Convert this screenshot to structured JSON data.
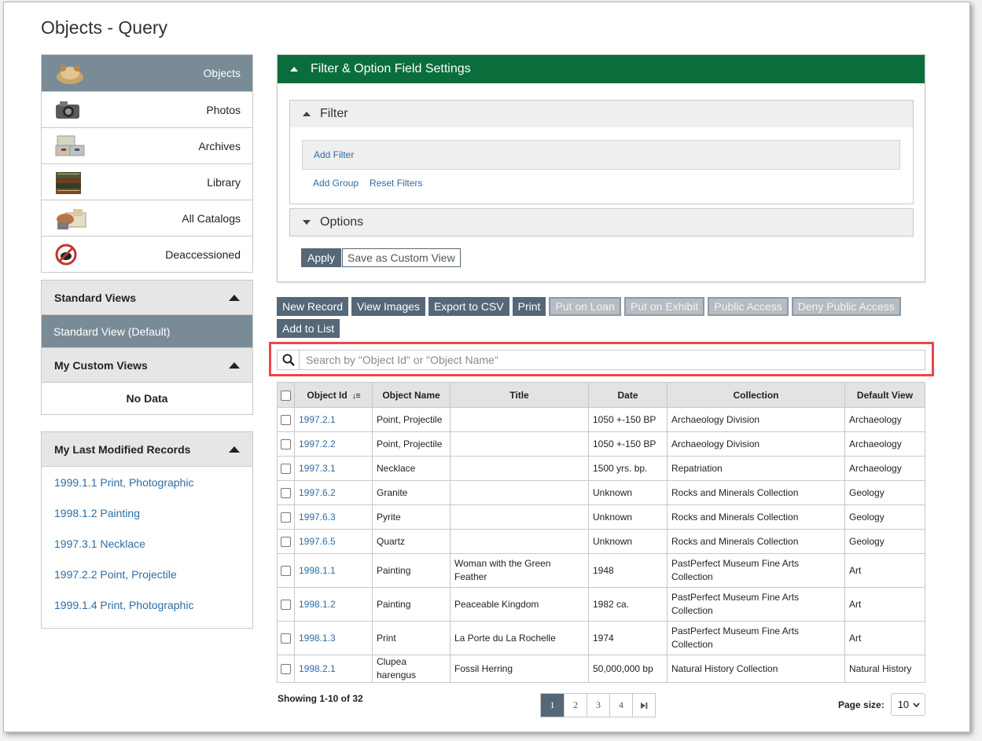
{
  "page": {
    "title": "Objects - Query"
  },
  "categories": [
    {
      "label": "Objects",
      "icon": "objects-thumbnail-icon",
      "active": true
    },
    {
      "label": "Photos",
      "icon": "camera-thumbnail-icon",
      "active": false
    },
    {
      "label": "Archives",
      "icon": "archive-boxes-thumbnail-icon",
      "active": false
    },
    {
      "label": "Library",
      "icon": "books-thumbnail-icon",
      "active": false
    },
    {
      "label": "All Catalogs",
      "icon": "catalog-items-thumbnail-icon",
      "active": false
    },
    {
      "label": "Deaccessioned",
      "icon": "deaccession-icon",
      "active": false
    }
  ],
  "views": {
    "standard_title": "Standard Views",
    "standard_item": "Standard View (Default)",
    "custom_title": "My Custom Views",
    "custom_empty": "No Data"
  },
  "recent": {
    "title": "My Last Modified Records",
    "items": [
      "1999.1.1 Print, Photographic",
      "1998.1.2 Painting",
      "1997.3.1 Necklace",
      "1997.2.2 Point, Projectile",
      "1999.1.4 Print, Photographic"
    ]
  },
  "filter_panel": {
    "title": "Filter & Option Field Settings",
    "filter_title": "Filter",
    "add_filter": "Add Filter",
    "add_group": "Add Group",
    "reset_filters": "Reset Filters",
    "options_title": "Options",
    "apply": "Apply",
    "save_custom": "Save as Custom View"
  },
  "toolbar": {
    "new_record": "New Record",
    "view_images": "View Images",
    "export_csv": "Export to CSV",
    "print": "Print",
    "put_on_loan": "Put on Loan",
    "put_on_exhibit": "Put on Exhibit",
    "public_access": "Public Access",
    "deny_public_access": "Deny Public Access",
    "add_to_list": "Add to List"
  },
  "search": {
    "placeholder": "Search by \"Object Id\" or \"Object Name\"",
    "highlight_color": "#e8474c"
  },
  "table": {
    "headers": [
      "Object Id",
      "Object Name",
      "Title",
      "Date",
      "Collection",
      "Default View"
    ],
    "rows": [
      [
        "1997.2.1",
        "Point, Projectile",
        "",
        "1050 +-150 BP",
        "Archaeology Division",
        "Archaeology"
      ],
      [
        "1997.2.2",
        "Point, Projectile",
        "",
        "1050 +-150 BP",
        "Archaeology Division",
        "Archaeology"
      ],
      [
        "1997.3.1",
        "Necklace",
        "",
        "1500 yrs. bp.",
        "Repatriation",
        "Archaeology"
      ],
      [
        "1997.6.2",
        "Granite",
        "",
        "Unknown",
        "Rocks and Minerals Collection",
        "Geology"
      ],
      [
        "1997.6.3",
        "Pyrite",
        "",
        "Unknown",
        "Rocks and Minerals Collection",
        "Geology"
      ],
      [
        "1997.6.5",
        "Quartz",
        "",
        "Unknown",
        "Rocks and Minerals Collection",
        "Geology"
      ],
      [
        "1998.1.1",
        "Painting",
        "Woman with the Green Feather",
        "1948",
        "PastPerfect Museum Fine Arts Collection",
        "Art"
      ],
      [
        "1998.1.2",
        "Painting",
        "Peaceable Kingdom",
        "1982 ca.",
        "PastPerfect Museum Fine Arts Collection",
        "Art"
      ],
      [
        "1998.1.3",
        "Print",
        "La Porte du La Rochelle",
        "1974",
        "PastPerfect Museum Fine Arts Collection",
        "Art"
      ],
      [
        "1998.2.1",
        "Clupea harengus",
        "Fossil Herring",
        "50,000,000 bp",
        "Natural History Collection",
        "Natural History"
      ]
    ]
  },
  "paging": {
    "showing": "Showing 1-10 of 32",
    "pages": [
      "1",
      "2",
      "3",
      "4"
    ],
    "current": "1",
    "page_size_label": "Page size:",
    "page_size": "10"
  },
  "colors": {
    "accent_green": "#0a6e3c",
    "button_slate": "#566777",
    "active_item": "#7a8b98",
    "link": "#2e6da4"
  }
}
